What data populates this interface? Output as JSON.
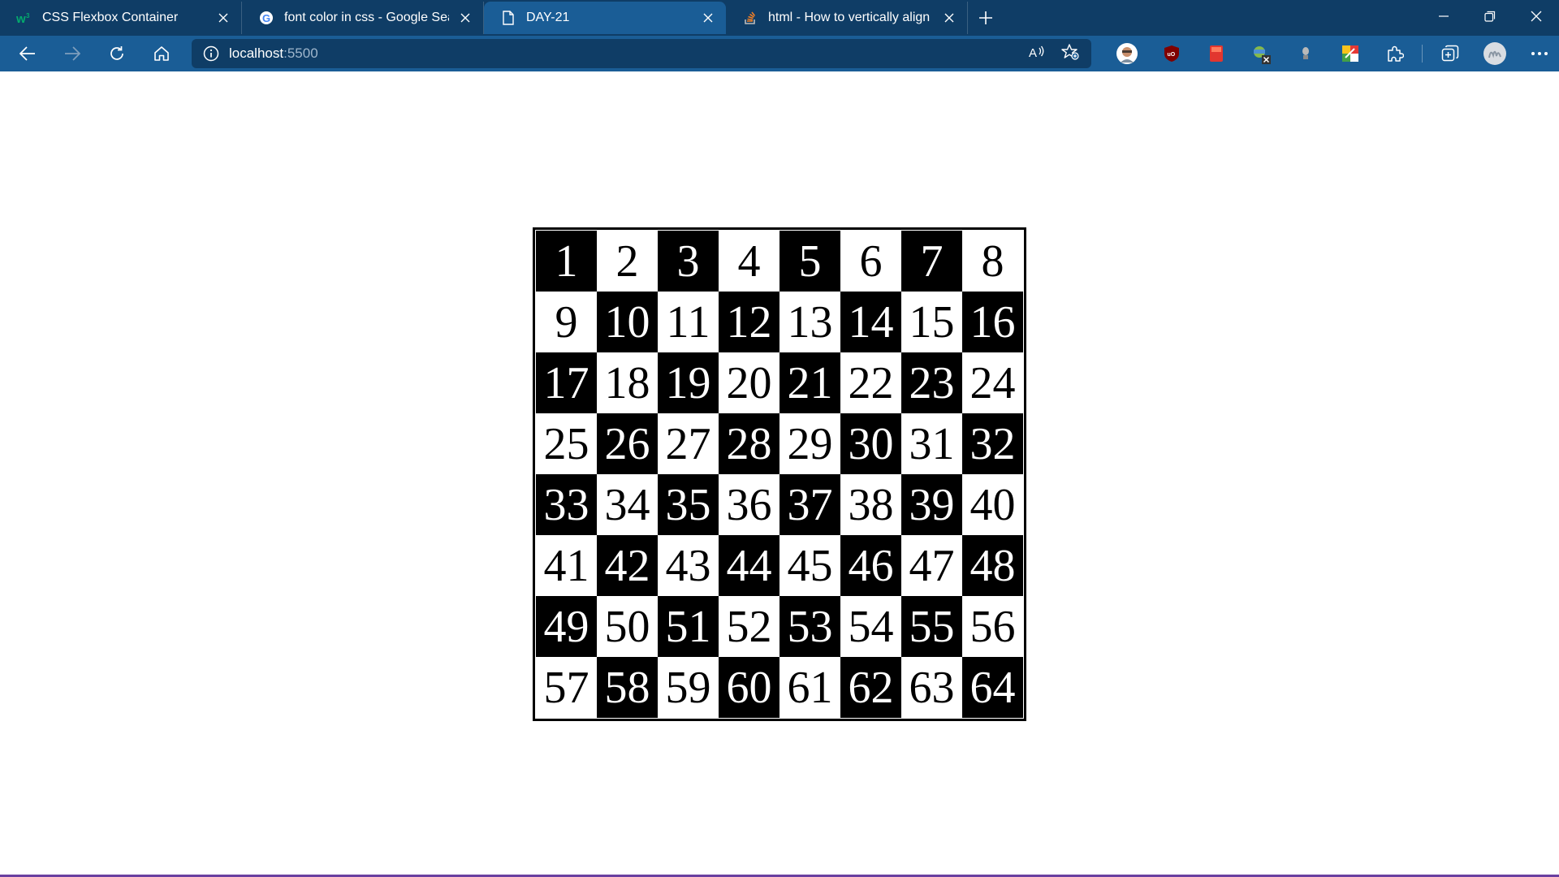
{
  "browser": {
    "tabs": [
      {
        "title": "CSS Flexbox Container",
        "icon": "w3schools-icon",
        "active": false
      },
      {
        "title": "font color in css - Google Search",
        "icon": "google-icon",
        "active": false
      },
      {
        "title": "DAY-21",
        "icon": "document-icon",
        "active": true
      },
      {
        "title": "html - How to vertically align text",
        "icon": "stackoverflow-icon",
        "active": false
      }
    ],
    "address": {
      "host": "localhost",
      "port": ":5500"
    },
    "colors": {
      "tabstrip": "#0f3d66",
      "toolbar": "#1a5d96"
    }
  },
  "page": {
    "board": {
      "rows": 8,
      "columns": 8,
      "first_cell_color": "black",
      "colors": {
        "dark": "#000000",
        "light": "#ffffff"
      },
      "cells": [
        "1",
        "2",
        "3",
        "4",
        "5",
        "6",
        "7",
        "8",
        "9",
        "10",
        "11",
        "12",
        "13",
        "14",
        "15",
        "16",
        "17",
        "18",
        "19",
        "20",
        "21",
        "22",
        "23",
        "24",
        "25",
        "26",
        "27",
        "28",
        "29",
        "30",
        "31",
        "32",
        "33",
        "34",
        "35",
        "36",
        "37",
        "38",
        "39",
        "40",
        "41",
        "42",
        "43",
        "44",
        "45",
        "46",
        "47",
        "48",
        "49",
        "50",
        "51",
        "52",
        "53",
        "54",
        "55",
        "56",
        "57",
        "58",
        "59",
        "60",
        "61",
        "62",
        "63",
        "64"
      ]
    }
  }
}
